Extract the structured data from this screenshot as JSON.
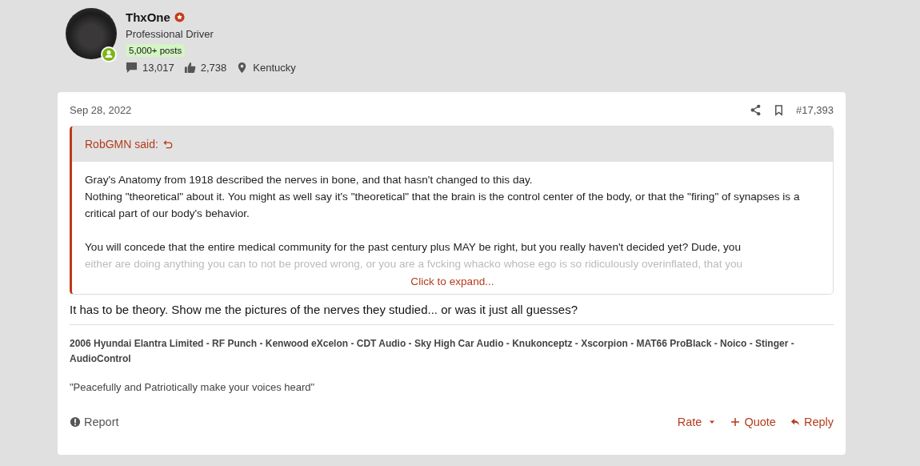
{
  "user": {
    "name": "ThxOne",
    "title": "Professional Driver",
    "badge": "5,000+ posts",
    "online": true,
    "stats": [
      {
        "kind": "messages",
        "value": "13,017"
      },
      {
        "kind": "likes",
        "value": "2,738"
      },
      {
        "kind": "location",
        "value": "Kentucky"
      }
    ]
  },
  "post": {
    "date": "Sep 28, 2022",
    "number": "#17,393",
    "quote": {
      "author": "RobGMN said:",
      "paragraphs": [
        [
          {
            "text": "Gray's Anatomy from 1918 described the nerves in bone, and that hasn't changed to this day.",
            "faded": false
          },
          {
            "text": "Nothing \"theoretical\" about it. You might as well say it's \"theoretical\" that the brain is the control center of the body, or that the \"firing\" of synapses is a critical part of our body's behavior.",
            "faded": false
          }
        ],
        [
          {
            "text": "You will concede that the entire medical community for the past century plus MAY be right, but you really haven't decided yet? Dude, you",
            "faded": false
          },
          {
            "text": "either are doing anything you can to not be proved wrong, or you are a fvcking whacko whose ego is so ridiculously overinflated, that you",
            "faded": true
          }
        ]
      ],
      "expand": "Click to expand..."
    },
    "body": "It has to be theory. Show me the pictures of the nerves they studied... or was it just all guesses?",
    "signature": "2006 Hyundai Elantra Limited - RF Punch - Kenwood eXcelon - CDT Audio - Sky High Car Audio - Knukonceptz - Xscorpion - MAT66 ProBlack - Noico - Stinger - AudioControl",
    "motto": "\"Peacefully and Patriotically make your voices heard\"",
    "report": "Report",
    "actions": [
      {
        "kind": "rate",
        "label": "Rate"
      },
      {
        "kind": "quote",
        "label": "Quote"
      },
      {
        "kind": "reply",
        "label": "Reply"
      }
    ]
  }
}
